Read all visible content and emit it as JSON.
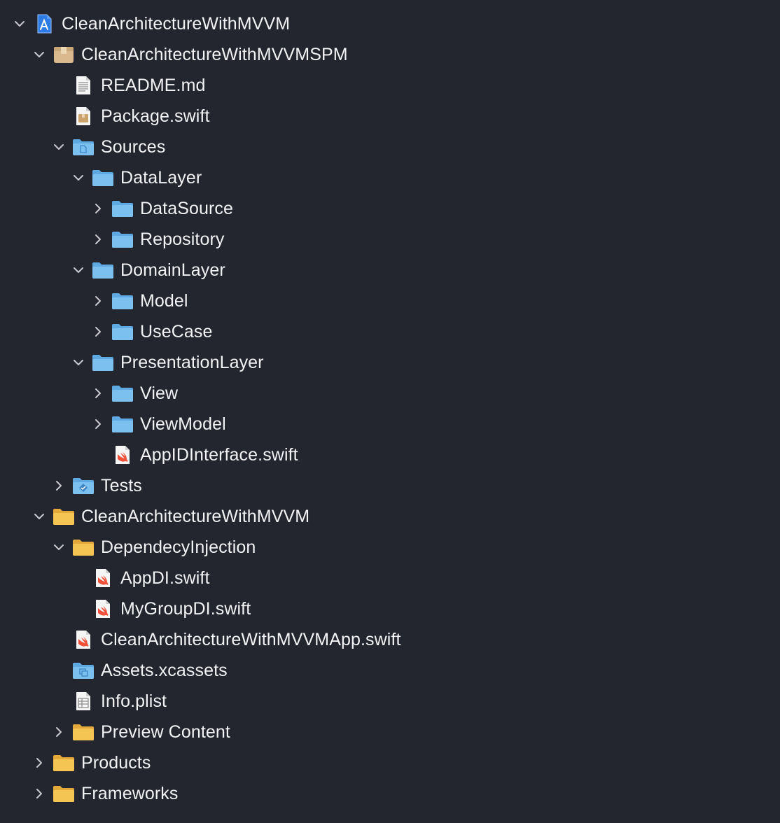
{
  "navigator": {
    "items": [
      {
        "label": "CleanArchitectureWithMVVM",
        "depth": 0,
        "icon": "xcode-project-icon",
        "disclosure": "expanded"
      },
      {
        "label": "CleanArchitectureWithMVVMSPM",
        "depth": 1,
        "icon": "package-icon",
        "disclosure": "expanded"
      },
      {
        "label": "README.md",
        "depth": 2,
        "icon": "markdown-file-icon",
        "disclosure": "none"
      },
      {
        "label": "Package.swift",
        "depth": 2,
        "icon": "package-manifest-icon",
        "disclosure": "none"
      },
      {
        "label": "Sources",
        "depth": 2,
        "icon": "blue-sources-folder-icon",
        "disclosure": "expanded"
      },
      {
        "label": "DataLayer",
        "depth": 3,
        "icon": "blue-folder-icon",
        "disclosure": "expanded"
      },
      {
        "label": "DataSource",
        "depth": 4,
        "icon": "blue-folder-icon",
        "disclosure": "collapsed"
      },
      {
        "label": "Repository",
        "depth": 4,
        "icon": "blue-folder-icon",
        "disclosure": "collapsed"
      },
      {
        "label": "DomainLayer",
        "depth": 3,
        "icon": "blue-folder-icon",
        "disclosure": "expanded"
      },
      {
        "label": "Model",
        "depth": 4,
        "icon": "blue-folder-icon",
        "disclosure": "collapsed"
      },
      {
        "label": "UseCase",
        "depth": 4,
        "icon": "blue-folder-icon",
        "disclosure": "collapsed"
      },
      {
        "label": "PresentationLayer",
        "depth": 3,
        "icon": "blue-folder-icon",
        "disclosure": "expanded"
      },
      {
        "label": "View",
        "depth": 4,
        "icon": "blue-folder-icon",
        "disclosure": "collapsed"
      },
      {
        "label": "ViewModel",
        "depth": 4,
        "icon": "blue-folder-icon",
        "disclosure": "collapsed"
      },
      {
        "label": "AppIDInterface.swift",
        "depth": 4,
        "icon": "swift-file-icon",
        "disclosure": "none"
      },
      {
        "label": "Tests",
        "depth": 2,
        "icon": "blue-tests-folder-icon",
        "disclosure": "collapsed"
      },
      {
        "label": "CleanArchitectureWithMVVM",
        "depth": 1,
        "icon": "yellow-folder-icon",
        "disclosure": "expanded"
      },
      {
        "label": "DependecyInjection",
        "depth": 2,
        "icon": "yellow-folder-icon",
        "disclosure": "expanded"
      },
      {
        "label": "AppDI.swift",
        "depth": 3,
        "icon": "swift-file-icon",
        "disclosure": "none"
      },
      {
        "label": "MyGroupDI.swift",
        "depth": 3,
        "icon": "swift-file-icon",
        "disclosure": "none"
      },
      {
        "label": "CleanArchitectureWithMVVMApp.swift",
        "depth": 2,
        "icon": "swift-file-icon",
        "disclosure": "none"
      },
      {
        "label": "Assets.xcassets",
        "depth": 2,
        "icon": "asset-catalog-icon",
        "disclosure": "none"
      },
      {
        "label": "Info.plist",
        "depth": 2,
        "icon": "plist-file-icon",
        "disclosure": "none"
      },
      {
        "label": "Preview Content",
        "depth": 2,
        "icon": "yellow-folder-icon",
        "disclosure": "collapsed"
      },
      {
        "label": "Products",
        "depth": 1,
        "icon": "yellow-folder-icon",
        "disclosure": "collapsed"
      },
      {
        "label": "Frameworks",
        "depth": 1,
        "icon": "yellow-folder-icon",
        "disclosure": "collapsed"
      }
    ]
  },
  "colors": {
    "background": "#24262f",
    "text": "#f2f2f4",
    "blue_folder": "#7cc0ef",
    "yellow_folder": "#f4c553",
    "chevron": "#c9c9ce",
    "swift_orange": "#f05138"
  }
}
